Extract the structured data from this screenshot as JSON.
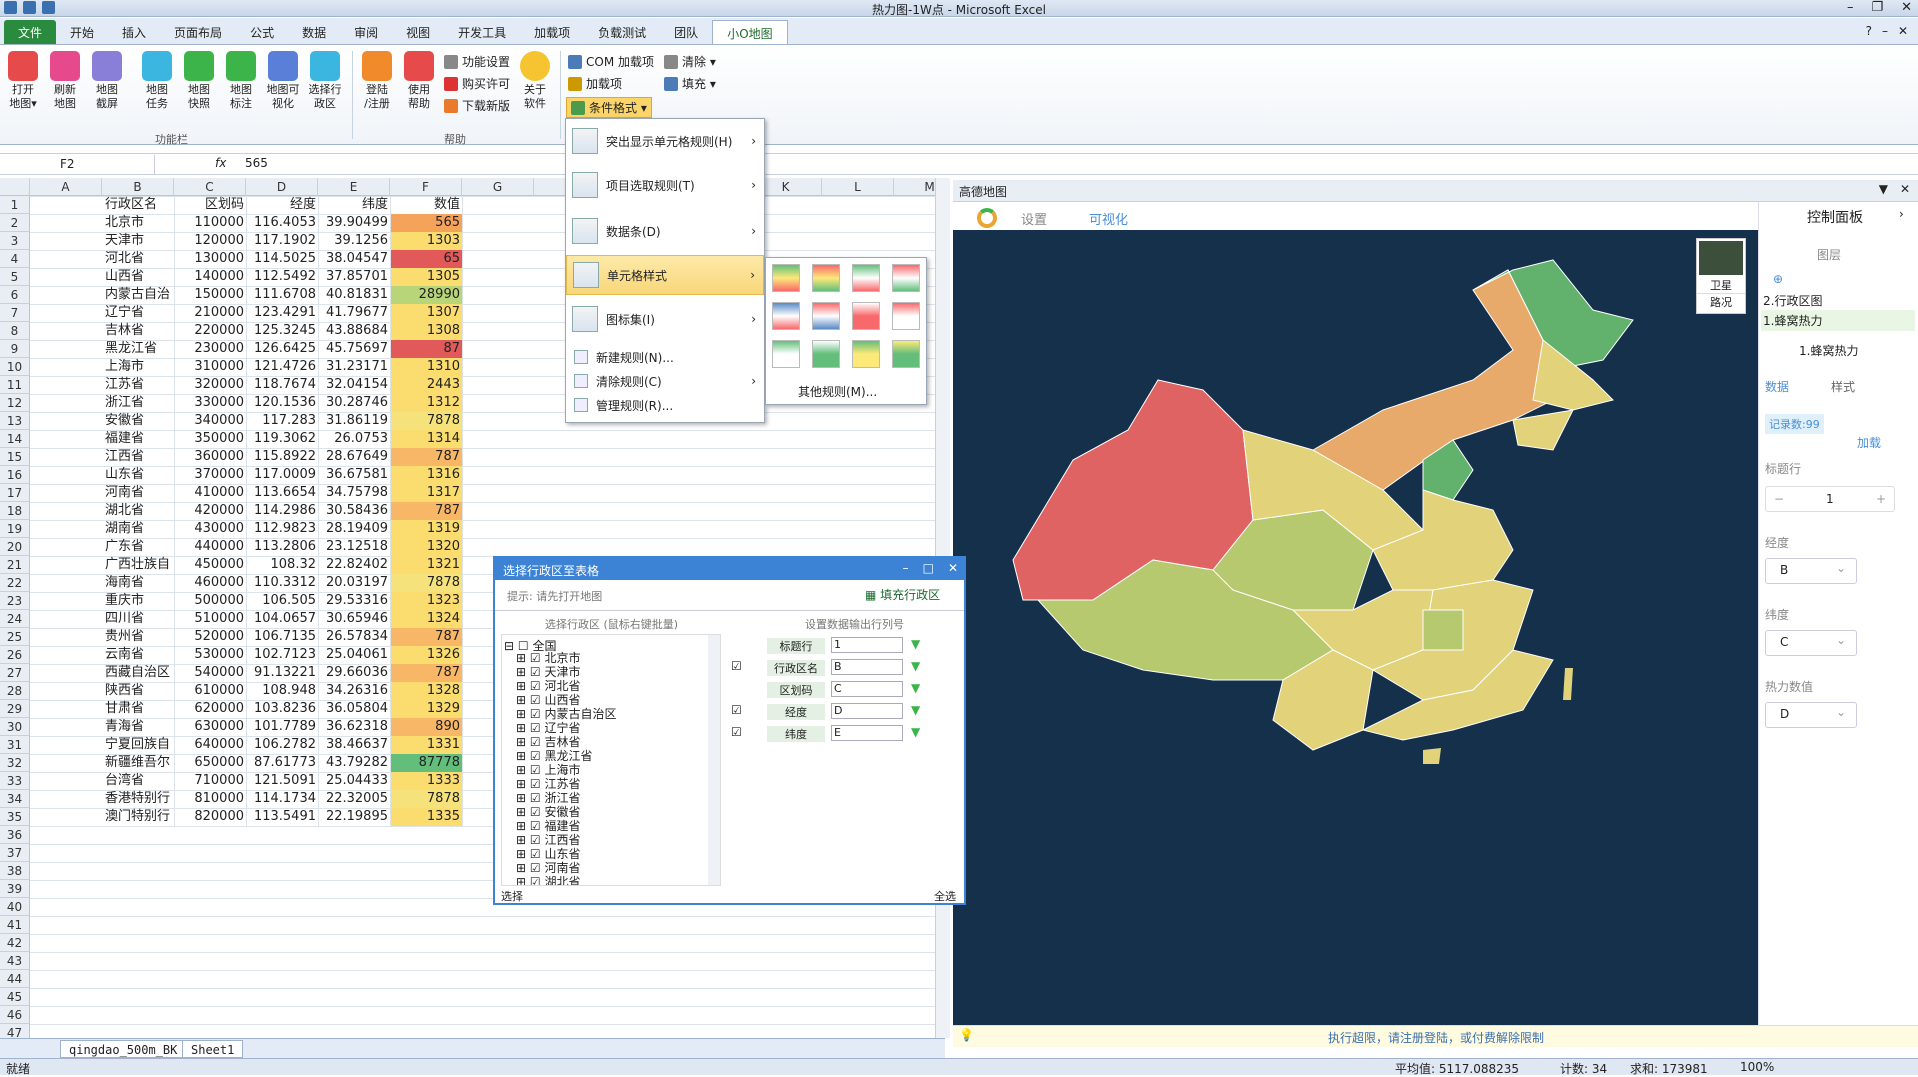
{
  "app": {
    "title": "热力图-1W点 - Microsoft Excel"
  },
  "tabs": [
    "文件",
    "开始",
    "插入",
    "页面布局",
    "公式",
    "数据",
    "审阅",
    "视图",
    "开发工具",
    "加载项",
    "负载测试",
    "团队",
    "小O地图"
  ],
  "ribbon": {
    "btns": [
      {
        "label1": "打开",
        "label2": "地图▾",
        "color": "#e64a4a"
      },
      {
        "label1": "刷新",
        "label2": "地图",
        "color": "#e64a8c"
      },
      {
        "label1": "地图",
        "label2": "截屏",
        "color": "#8a7fd8"
      },
      {
        "label1": "地图",
        "label2": "任务",
        "color": "#3bb6e0"
      },
      {
        "label1": "地图",
        "label2": "快照",
        "color": "#3cb44a"
      },
      {
        "label1": "地图",
        "label2": "标注",
        "color": "#3cb44a"
      },
      {
        "label1": "地图可",
        "label2": "视化",
        "color": "#5a7fd8"
      },
      {
        "label1": "选择行",
        "label2": "政区",
        "color": "#3bb6e0"
      },
      {
        "label1": "登陆",
        "label2": "/注册",
        "color": "#f08a2a"
      },
      {
        "label1": "使用",
        "label2": "帮助",
        "color": "#e64a4a"
      }
    ],
    "group1": "功能栏",
    "group2": "帮助",
    "small": [
      "功能设置",
      "购买许可",
      "下载新版"
    ],
    "about": {
      "l1": "关于",
      "l2": "软件"
    },
    "addins": [
      "COM 加载项",
      "清除 ▾",
      "加载项",
      "填充 ▾",
      "条件格式 ▾"
    ]
  },
  "formula": {
    "name": "F2",
    "value": "565",
    "fx": "fx"
  },
  "columns": [
    "A",
    "B",
    "C",
    "D",
    "E",
    "F",
    "G",
    "H",
    "I",
    "J",
    "K",
    "L",
    "M"
  ],
  "rows": [
    [
      "行政区名",
      "区划码",
      "经度",
      "纬度",
      "数值",
      ""
    ],
    [
      "北京市",
      "110000",
      "116.4053",
      "39.90499",
      "565",
      "#f5a25a"
    ],
    [
      "天津市",
      "120000",
      "117.1902",
      "39.1256",
      "1303",
      "#fbdd6f"
    ],
    [
      "河北省",
      "130000",
      "114.5025",
      "38.04547",
      "65",
      "#e2595a"
    ],
    [
      "山西省",
      "140000",
      "112.5492",
      "37.85701",
      "1305",
      "#fbdd6f"
    ],
    [
      "内蒙古自治",
      "150000",
      "111.6708",
      "40.81831",
      "28990",
      "#b8d57a"
    ],
    [
      "辽宁省",
      "210000",
      "123.4291",
      "41.79677",
      "1307",
      "#fbdd6f"
    ],
    [
      "吉林省",
      "220000",
      "125.3245",
      "43.88684",
      "1308",
      "#fbdd6f"
    ],
    [
      "黑龙江省",
      "230000",
      "126.6425",
      "45.75697",
      "87",
      "#e2595a"
    ],
    [
      "上海市",
      "310000",
      "121.4726",
      "31.23171",
      "1310",
      "#fbdd6f"
    ],
    [
      "江苏省",
      "320000",
      "118.7674",
      "32.04154",
      "2443",
      "#fbdd6f"
    ],
    [
      "浙江省",
      "330000",
      "120.1536",
      "30.28746",
      "1312",
      "#fbdd6f"
    ],
    [
      "安徽省",
      "340000",
      "117.283",
      "31.86119",
      "7878",
      "#f6e27a"
    ],
    [
      "福建省",
      "350000",
      "119.3062",
      "26.0753",
      "1314",
      "#fbdd6f"
    ],
    [
      "江西省",
      "360000",
      "115.8922",
      "28.67649",
      "787",
      "#f8b766"
    ],
    [
      "山东省",
      "370000",
      "117.0009",
      "36.67581",
      "1316",
      "#fbdd6f"
    ],
    [
      "河南省",
      "410000",
      "113.6654",
      "34.75798",
      "1317",
      "#fbdd6f"
    ],
    [
      "湖北省",
      "420000",
      "114.2986",
      "30.58436",
      "787",
      "#f8b766"
    ],
    [
      "湖南省",
      "430000",
      "112.9823",
      "28.19409",
      "1319",
      "#fbdd6f"
    ],
    [
      "广东省",
      "440000",
      "113.2806",
      "23.12518",
      "1320",
      "#fbdd6f"
    ],
    [
      "广西壮族自",
      "450000",
      "108.32",
      "22.82402",
      "1321",
      "#fbdd6f"
    ],
    [
      "海南省",
      "460000",
      "110.3312",
      "20.03197",
      "7878",
      "#f6e27a"
    ],
    [
      "重庆市",
      "500000",
      "106.505",
      "29.53316",
      "1323",
      "#fbdd6f"
    ],
    [
      "四川省",
      "510000",
      "104.0657",
      "30.65946",
      "1324",
      "#fbdd6f"
    ],
    [
      "贵州省",
      "520000",
      "106.7135",
      "26.57834",
      "787",
      "#f8b766"
    ],
    [
      "云南省",
      "530000",
      "102.7123",
      "25.04061",
      "1326",
      "#fbdd6f"
    ],
    [
      "西藏自治区",
      "540000",
      "91.13221",
      "29.66036",
      "787",
      "#f8b766"
    ],
    [
      "陕西省",
      "610000",
      "108.948",
      "34.26316",
      "1328",
      "#fbdd6f"
    ],
    [
      "甘肃省",
      "620000",
      "103.8236",
      "36.05804",
      "1329",
      "#fbdd6f"
    ],
    [
      "青海省",
      "630000",
      "101.7789",
      "36.62318",
      "890",
      "#f8b766"
    ],
    [
      "宁夏回族自",
      "640000",
      "106.2782",
      "38.46637",
      "1331",
      "#fbdd6f"
    ],
    [
      "新疆维吾尔",
      "650000",
      "87.61773",
      "43.79282",
      "87778",
      "#63be7b"
    ],
    [
      "台湾省",
      "710000",
      "121.5091",
      "25.04433",
      "1333",
      "#fbdd6f"
    ],
    [
      "香港特别行",
      "810000",
      "114.1734",
      "22.32005",
      "7878",
      "#f6e27a"
    ],
    [
      "澳门特别行",
      "820000",
      "113.5491",
      "22.19895",
      "1335",
      "#fbdd6f"
    ]
  ],
  "rowcount": 47,
  "sheettabs": [
    "qingdao_500m_BK",
    "Sheet1"
  ],
  "status": {
    "mode": "就绪",
    "avg": "平均值: 5117.088235",
    "count": "计数: 34",
    "sum": "求和: 173981",
    "zoom": "100%"
  },
  "cfmenu": {
    "items": [
      "突出显示单元格规则(H)",
      "项目选取规则(T)",
      "数据条(D)",
      "单元格样式",
      "图标集(I)"
    ],
    "small": [
      "新建规则(N)...",
      "清除规则(C)",
      "管理规则(R)..."
    ],
    "other": "其他规则(M)..."
  },
  "dialog": {
    "title": "选择行政区至表格",
    "hint": "提示:  请先打开地图",
    "fill": "填充行政区",
    "left_hdr": "选择行政区 (鼠标右键批量)",
    "right_hdr": "设置数据输出行列号",
    "root": "全国",
    "tree": [
      "北京市",
      "天津市",
      "河北省",
      "山西省",
      "内蒙古自治区",
      "辽宁省",
      "吉林省",
      "黑龙江省",
      "上海市",
      "江苏省",
      "浙江省",
      "安徽省",
      "福建省",
      "江西省",
      "山东省",
      "河南省",
      "湖北省"
    ],
    "fields": [
      {
        "label": "标题行",
        "value": "1",
        "checked": false
      },
      {
        "label": "行政区名",
        "value": "B",
        "checked": true
      },
      {
        "label": "区划码",
        "value": "C",
        "checked": false
      },
      {
        "label": "经度",
        "value": "D",
        "checked": true
      },
      {
        "label": "纬度",
        "value": "E",
        "checked": true
      }
    ],
    "footer_left": "选择",
    "footer_right": "全选"
  },
  "map": {
    "panel_title": "高德地图",
    "tabs": [
      "设置",
      "可视化"
    ],
    "sat": "卫星",
    "road": "路况",
    "warning": "执行超限，请注册登陆，或付费解除限制",
    "colors": {
      "bg": "#14304a",
      "land": "#e2d27a",
      "red": "#e06363",
      "orange": "#e8aa6a",
      "green": "#62b26e",
      "lightgreen": "#b7c96f"
    }
  },
  "control": {
    "title": "控制面板",
    "layers_label": "图层",
    "layers": [
      "2.行政区图",
      "1.蜂窝热力"
    ],
    "selected_layer": "1.蜂窝热力",
    "tabs": [
      "数据",
      "样式"
    ],
    "record": "记录数:99",
    "load": "加载",
    "title_row_label": "标题行",
    "title_row": "1",
    "minus": "−",
    "plus": "+",
    "lng_label": "经度",
    "lng": "B",
    "lat_label": "纬度",
    "lat": "C",
    "heat_label": "热力数值",
    "heat": "D"
  }
}
